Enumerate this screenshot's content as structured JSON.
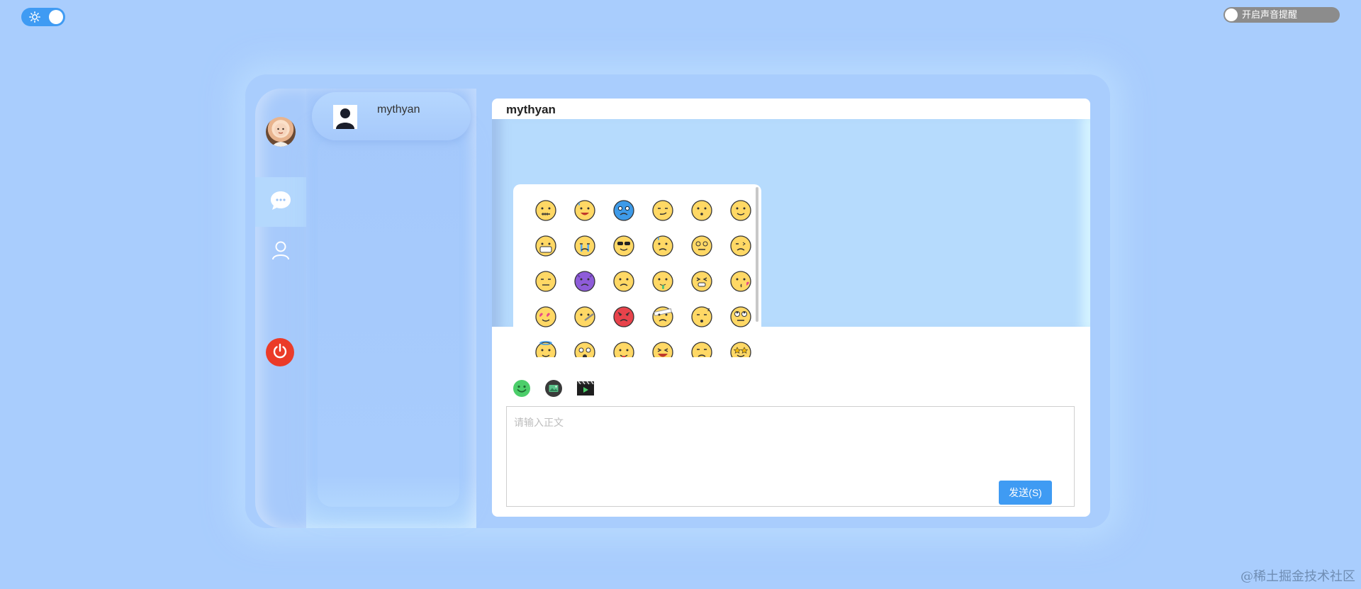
{
  "theme_toggle": {
    "icon": "sun-icon",
    "state": "on"
  },
  "sound_toggle": {
    "label": "开启声音提醒",
    "state": "off"
  },
  "sidebar": {
    "avatar": "user-avatar",
    "nav": [
      {
        "name": "chat",
        "icon": "chat-bubble-icon",
        "active": true
      },
      {
        "name": "contacts",
        "icon": "user-icon",
        "active": false
      }
    ],
    "power_icon": "power-icon",
    "power_color": "#eb3b28"
  },
  "contacts": [
    {
      "name": "mythyan"
    }
  ],
  "chat": {
    "title": "mythyan",
    "toolbar": [
      "emoji-icon",
      "image-icon",
      "video-icon"
    ],
    "input": {
      "placeholder": "请输入正文",
      "value": ""
    },
    "send_label": "发送(S)"
  },
  "emoji_panel": {
    "rows": [
      [
        "zipper-mouth",
        "sweat-smile",
        "cold-blue",
        "smirk",
        "hushed",
        "slight-smile"
      ],
      [
        "mask",
        "crying",
        "sunglasses",
        "sweat-sad",
        "dizzy-eyes",
        "wink-frown"
      ],
      [
        "expressionless",
        "purple-devil",
        "frown",
        "drooling",
        "squint-grimace",
        "kissing-heart"
      ],
      [
        "heart-eyes",
        "thermometer",
        "angry-red",
        "bandaged",
        "sleepy-z",
        "rolling-eyes"
      ],
      [
        "halo",
        "astonished",
        "tongue-out",
        "grinning-squint",
        "unamused",
        "star-struck"
      ]
    ]
  },
  "colors": {
    "accent": "#3f9bf3",
    "background": "#a9cdfd",
    "danger": "#eb3b28"
  },
  "watermark": "@稀土掘金技术社区"
}
